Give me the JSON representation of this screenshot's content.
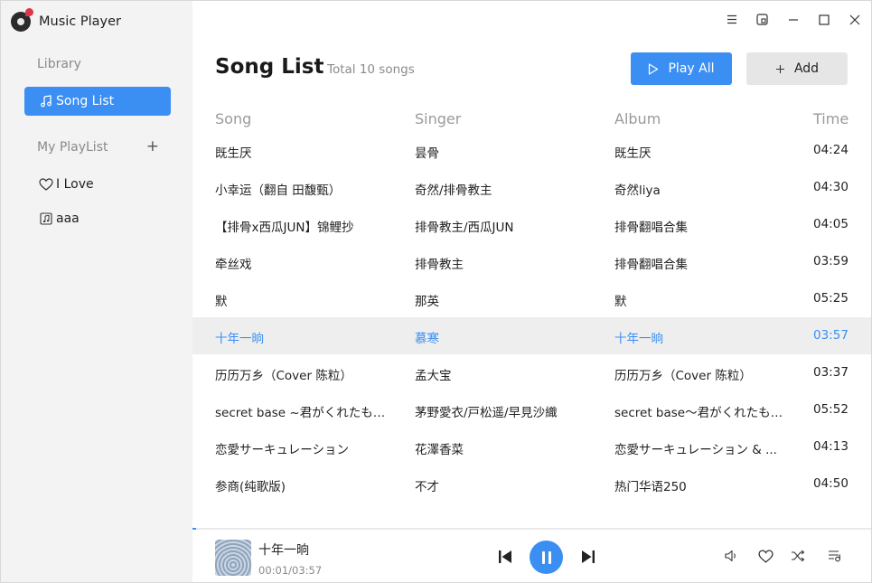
{
  "app": {
    "title": "Music Player",
    "logo_icon": "music-note-icon"
  },
  "sidebar": {
    "library_label": "Library",
    "song_list_label": "Song List",
    "playlist_label": "My PlayList",
    "playlists": [
      {
        "label": "I Love",
        "icon": "heart-icon"
      },
      {
        "label": "aaa",
        "icon": "music-file-icon"
      }
    ]
  },
  "header": {
    "title": "Song List",
    "subtitle": "Total 10 songs",
    "play_all_label": "Play All",
    "add_label": "Add"
  },
  "table": {
    "columns": [
      "Song",
      "Singer",
      "Album",
      "Time"
    ],
    "rows": [
      {
        "song": "既生厌",
        "singer": "昙骨",
        "album": "既生厌",
        "time": "04:24"
      },
      {
        "song": "小幸运（翻自 田馥甄）",
        "singer": "奇然/排骨教主",
        "album": "奇然liya",
        "time": "04:30"
      },
      {
        "song": "【排骨x西瓜JUN】锦鲤抄",
        "singer": "排骨教主/西瓜JUN",
        "album": "排骨翻唱合集",
        "time": "04:05"
      },
      {
        "song": "牵丝戏",
        "singer": "排骨教主",
        "album": "排骨翻唱合集",
        "time": "03:59"
      },
      {
        "song": "默",
        "singer": "那英",
        "album": "默",
        "time": "05:25"
      },
      {
        "song": "十年一晌",
        "singer": "慕寒",
        "album": "十年一晌",
        "time": "03:57"
      },
      {
        "song": "历历万乡（Cover 陈粒）",
        "singer": "孟大宝",
        "album": "历历万乡（Cover 陈粒）",
        "time": "03:37"
      },
      {
        "song": "secret base ~君がくれたもの~",
        "singer": "茅野愛衣/戸松遥/早見沙織",
        "album": "secret base～君がくれたもの～",
        "time": "05:52"
      },
      {
        "song": "恋愛サーキュレーション",
        "singer": "花澤香菜",
        "album": "恋愛サーキュレーション & ...",
        "time": "04:13"
      },
      {
        "song": "参商(纯歌版)",
        "singer": "不才",
        "album": "热门华语250",
        "time": "04:50"
      }
    ],
    "active_row_index": 5
  },
  "player": {
    "title": "十年一晌",
    "time": "00:01/03:57",
    "progress_fraction": 0.005
  },
  "colors": {
    "accent": "#3b8ff3",
    "sidebar_bg": "#f3f3f3",
    "active_row_bg": "#eeeeee"
  }
}
